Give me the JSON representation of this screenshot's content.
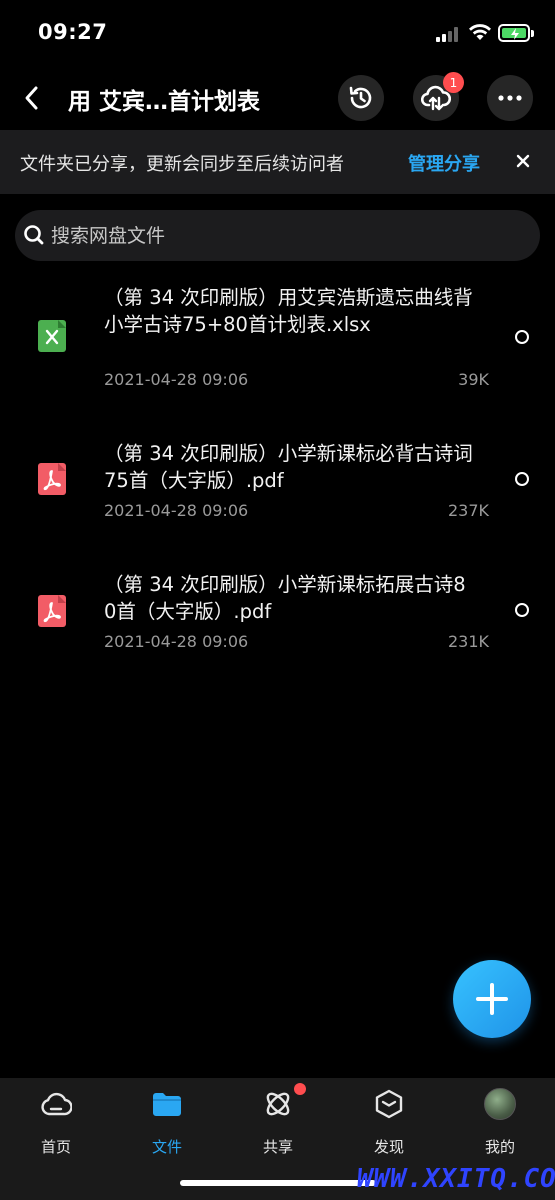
{
  "status_bar": {
    "time": "09:27"
  },
  "nav": {
    "title": "用 艾宾…首计划表",
    "upload_badge": "1"
  },
  "share_banner": {
    "text": "文件夹已分享，更新会同步至后续访问者",
    "manage_label": "管理分享"
  },
  "search": {
    "placeholder": "搜索网盘文件"
  },
  "files": [
    {
      "type": "xlsx",
      "name": "（第 34 次印刷版）用艾宾浩斯遗忘曲线背小学古诗75+80首计划表.xlsx",
      "date": "2021-04-28 09:06",
      "size": "39K"
    },
    {
      "type": "pdf",
      "name": "（第 34 次印刷版）小学新课标必背古诗词75首（大字版）.pdf",
      "date": "2021-04-28 09:06",
      "size": "237K"
    },
    {
      "type": "pdf",
      "name": "（第 34 次印刷版）小学新课标拓展古诗80首（大字版）.pdf",
      "date": "2021-04-28 09:06",
      "size": "231K"
    }
  ],
  "tabs": [
    {
      "label": "首页",
      "icon": "cloud-icon"
    },
    {
      "label": "文件",
      "icon": "folder-icon"
    },
    {
      "label": "共享",
      "icon": "atom-icon"
    },
    {
      "label": "发现",
      "icon": "cube-icon"
    },
    {
      "label": "我的",
      "icon": "avatar"
    }
  ],
  "watermark": "WWW.XXITQ.COM",
  "colors": {
    "accent": "#2aa7f2",
    "badge": "#ff4d4f",
    "xlsx": "#4caf50",
    "pdf": "#f25c66"
  }
}
